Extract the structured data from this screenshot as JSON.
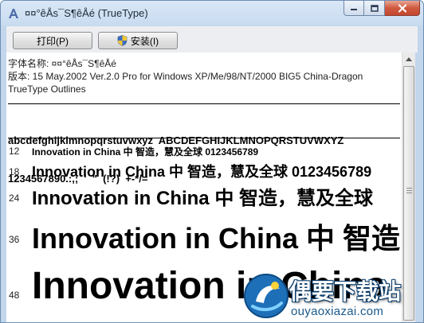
{
  "window": {
    "title": "¤¤°êÅs¯S¶êÅé (TrueType)",
    "minimize_label": "minimize",
    "maximize_label": "maximize",
    "close_label": "close"
  },
  "toolbar": {
    "print_label": "打印(P)",
    "install_label": "安装(I)"
  },
  "font_info": {
    "name_line": "字体名称: ¤¤°êÅs¯S¶êÅé",
    "version_line_1": "版本: 15 May.2002 Ver.2.0 Pro for Windows XP/Me/98/NT/2000 BIG5 China-Dragon",
    "version_line_2": "TrueType Outlines"
  },
  "charset": {
    "line1": "abcdefghijklmnopqrstuvwxyz  ABCDEFGHIJKLMNOPQRSTUVWXYZ",
    "line2": "1234567890.:,;  '  \"  (!?)  +-*/="
  },
  "samples": [
    {
      "size": "12",
      "text": "Innovation in China 中 智造，慧及全球 0123456789"
    },
    {
      "size": "18",
      "text": "Innovation in China 中 智造，慧及全球 0123456789"
    },
    {
      "size": "24",
      "text": "Innovation in China 中 智造，慧及全球"
    },
    {
      "size": "36",
      "text": "Innovation in China 中 智造"
    },
    {
      "size": "48",
      "text": "Innovation in China"
    }
  ],
  "watermark": {
    "text": "偶要下载站",
    "url": "ouyaoxiazai.com"
  },
  "colors": {
    "title_bar": "#c9dcf0",
    "close_button": "#c44730",
    "toolbar": "#eceef2",
    "watermark_blue": "#1a5a8c"
  },
  "icons": {
    "app": "font-viewer-icon",
    "install": "uac-shield-icon"
  }
}
